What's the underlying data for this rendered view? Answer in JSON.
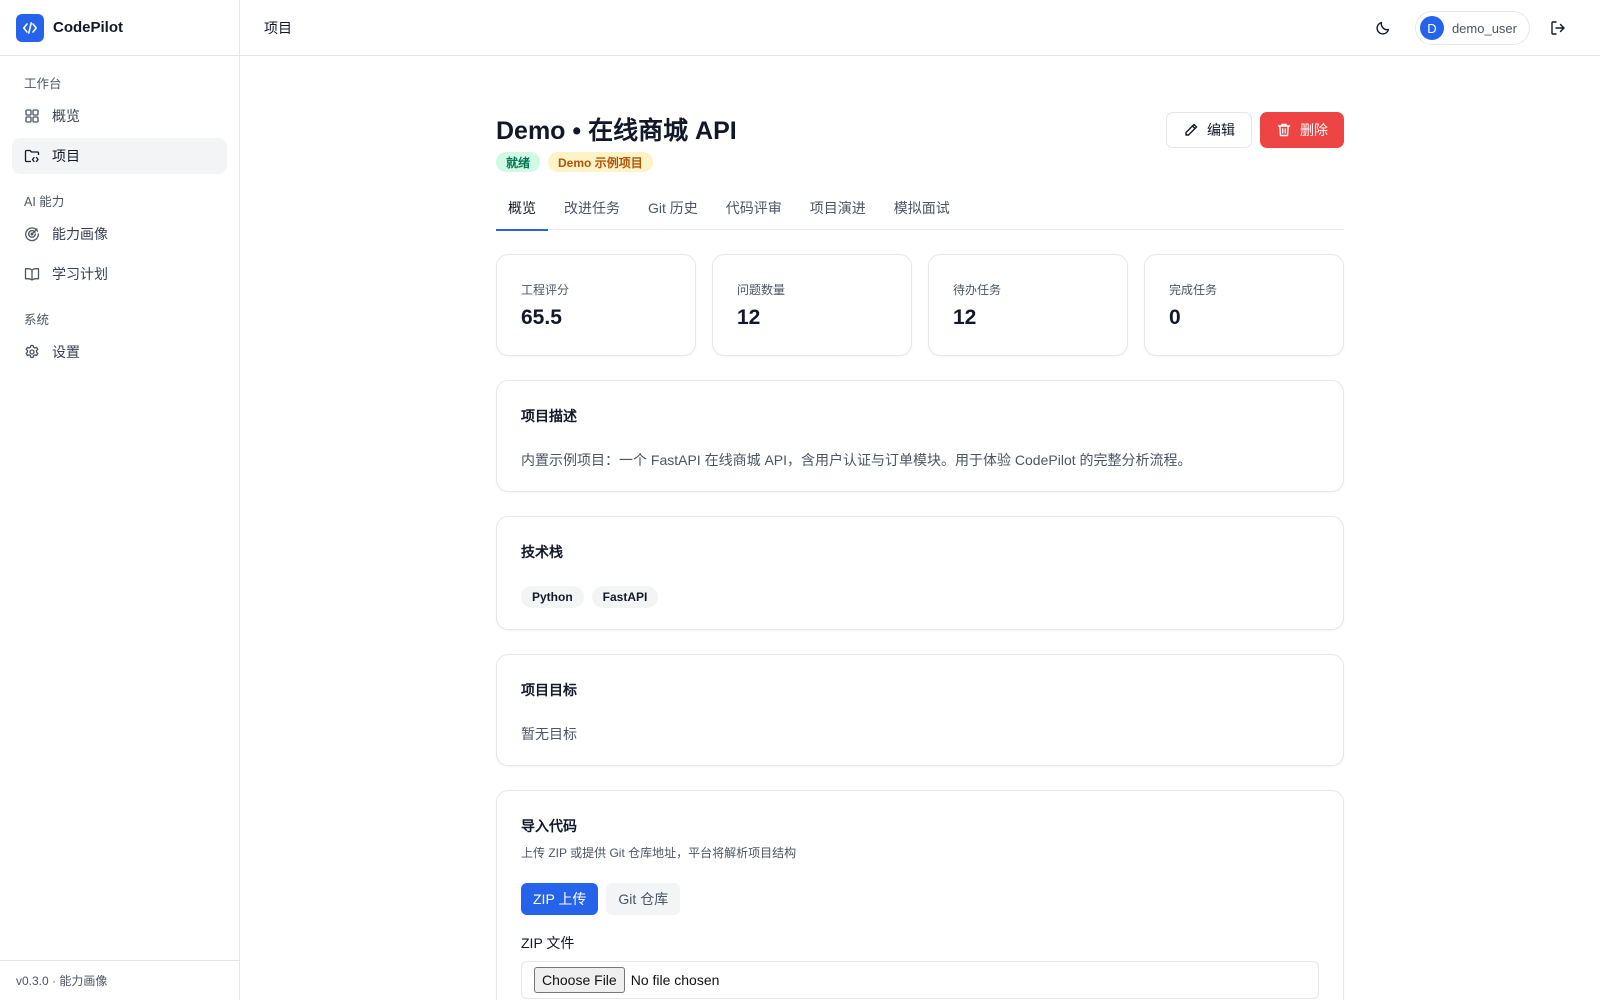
{
  "app": {
    "name": "CodePilot",
    "version_text": "v0.3.0 · 能力画像"
  },
  "sidebar": {
    "sections": [
      {
        "title": "工作台",
        "items": [
          {
            "label": "概览",
            "icon": "grid-icon"
          },
          {
            "label": "项目",
            "icon": "folder-code-icon",
            "active": true
          }
        ]
      },
      {
        "title": "AI 能力",
        "items": [
          {
            "label": "能力画像",
            "icon": "radar-icon"
          },
          {
            "label": "学习计划",
            "icon": "book-icon"
          }
        ]
      },
      {
        "title": "系统",
        "items": [
          {
            "label": "设置",
            "icon": "gear-icon"
          }
        ]
      }
    ]
  },
  "header": {
    "title": "项目",
    "username": "demo_user",
    "avatar_initial": "D"
  },
  "project": {
    "title": "Demo • 在线商城 API",
    "badges": {
      "status": "就绪",
      "demo": "Demo 示例项目"
    },
    "edit_label": "编辑",
    "delete_label": "删除"
  },
  "tabs": [
    "概览",
    "改进任务",
    "Git 历史",
    "代码评审",
    "项目演进",
    "模拟面试"
  ],
  "stats": [
    {
      "label": "工程评分",
      "value": "65.5"
    },
    {
      "label": "问题数量",
      "value": "12"
    },
    {
      "label": "待办任务",
      "value": "12"
    },
    {
      "label": "完成任务",
      "value": "0"
    }
  ],
  "description": {
    "title": "项目描述",
    "text": "内置示例项目：一个 FastAPI 在线商城 API，含用户认证与订单模块。用于体验 CodePilot 的完整分析流程。"
  },
  "tech_stack": {
    "title": "技术栈",
    "items": [
      "Python",
      "FastAPI"
    ]
  },
  "goals": {
    "title": "项目目标",
    "text": "暂无目标"
  },
  "import": {
    "title": "导入代码",
    "subtitle": "上传 ZIP 或提供 Git 仓库地址，平台将解析项目结构",
    "zip_tab": "ZIP 上传",
    "git_tab": "Git 仓库",
    "field_label": "ZIP 文件",
    "choose_file": "Choose File",
    "file_status": "No file chosen"
  },
  "colors": {
    "accent": "#2563eb",
    "danger": "#ef4444",
    "success_bg": "#d1fae5",
    "warning_bg": "#fef3c7"
  }
}
